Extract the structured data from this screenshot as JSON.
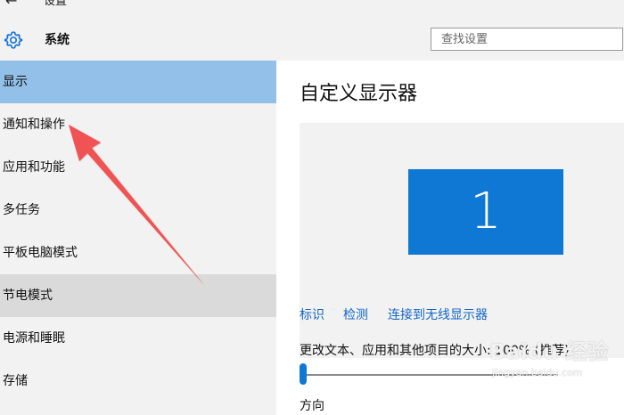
{
  "window": {
    "title": "设置",
    "back_icon": "back-arrow-icon"
  },
  "header": {
    "app_title": "系统",
    "app_icon": "gear-icon",
    "search_placeholder": "查找设置"
  },
  "sidebar": {
    "items": [
      {
        "label": "显示"
      },
      {
        "label": "通知和操作"
      },
      {
        "label": "应用和功能"
      },
      {
        "label": "多任务"
      },
      {
        "label": "平板电脑模式"
      },
      {
        "label": "节电模式"
      },
      {
        "label": "电源和睡眠"
      },
      {
        "label": "存储"
      }
    ]
  },
  "main": {
    "title": "自定义显示器",
    "monitor_number": "1",
    "links": {
      "identify": "标识",
      "detect": "检测",
      "wireless": "连接到无线显示器"
    },
    "scale_label": "更改文本、应用和其他项目的大小: 100% (推荐)",
    "slider_value_percent": 100,
    "orientation_label": "方向"
  },
  "watermark": {
    "logo": "Baidu 经验",
    "sub": "jingyan.baidu.com"
  },
  "colors": {
    "accent": "#0f78d4",
    "selected_nav": "#93c0e8",
    "hover_nav": "#dadada",
    "annotation_arrow": "#ef4b4b"
  }
}
